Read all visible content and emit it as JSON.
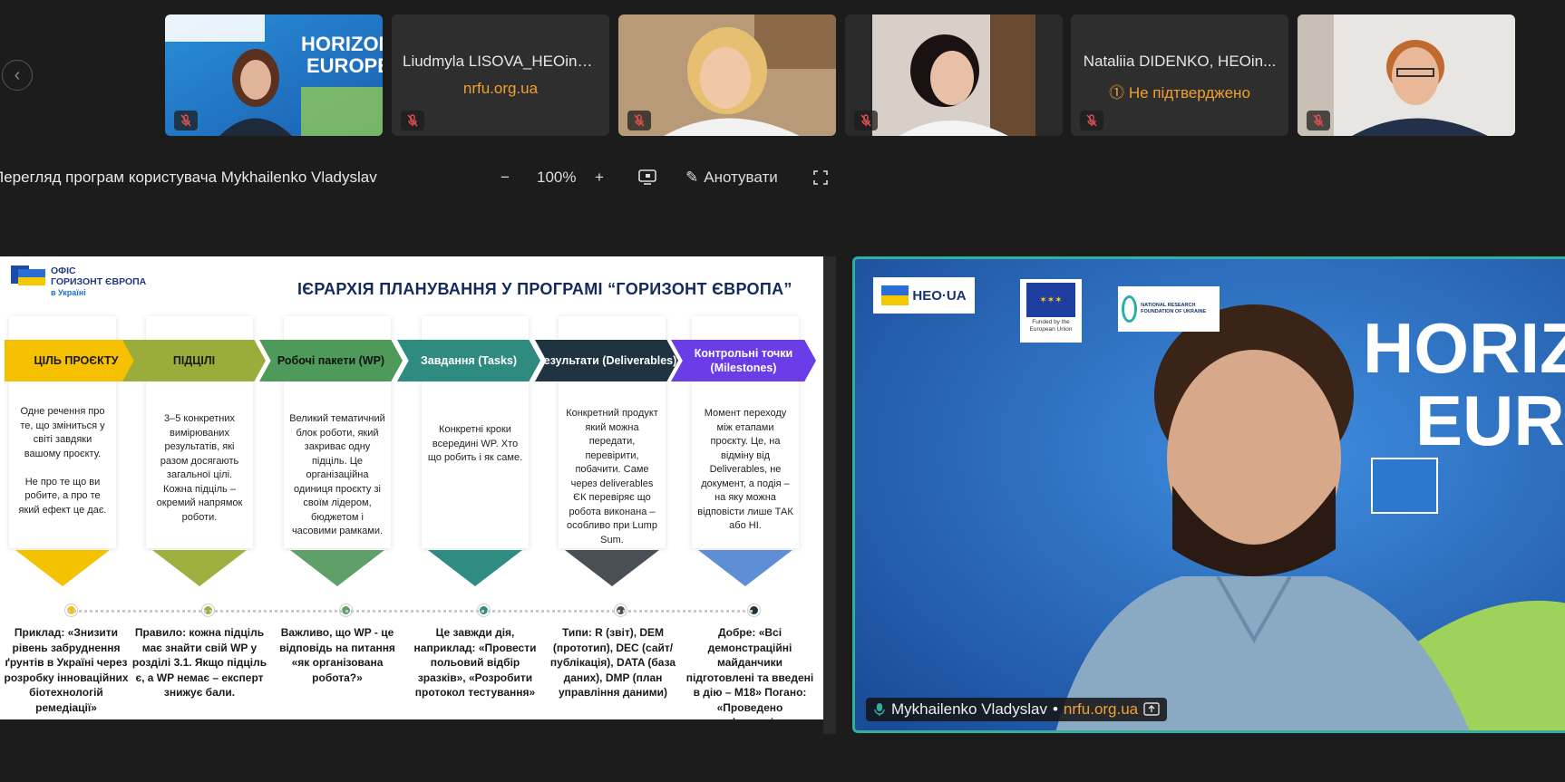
{
  "participants": [
    {
      "name": "",
      "sub": "",
      "muted": true,
      "has_video": true
    },
    {
      "name": "Liudmyla LISOVA_HEOinUA",
      "sub": "nrfu.org.ua",
      "muted": true,
      "has_video": false
    },
    {
      "name": "",
      "sub": "",
      "muted": true,
      "has_video": true
    },
    {
      "name": "",
      "sub": "",
      "muted": true,
      "has_video": true
    },
    {
      "name": "Nataliia DIDENKO, HEOin...",
      "sub": "Не підтверджено",
      "muted": true,
      "has_video": false
    },
    {
      "name": "",
      "sub": "",
      "muted": true,
      "has_video": true
    }
  ],
  "share": {
    "title": "Перегляд програм користувача Mykhailenko Vladyslav",
    "zoom_out": "−",
    "zoom": "100%",
    "zoom_in": "+",
    "annotate": "Анотувати"
  },
  "slide": {
    "logo_line1": "ОФІС",
    "logo_line2": "ГОРИЗОНТ ЄВРОПА",
    "logo_line3": "в Україні",
    "title": "ІЄРАРХІЯ ПЛАНУВАННЯ У ПРОГРАМІ “ГОРИЗОНТ ЄВРОПА”",
    "columns": [
      {
        "header": "ЦІЛЬ ПРОЄКТУ",
        "color": "#f5c000",
        "text_color": "#1a1a1a",
        "chev_color": "#f5c200",
        "desc": "Одне речення про те, що зміниться у світі завдяки вашому проєкту.\n\nНе про те що ви робите, а про те який ефект це дає.",
        "bottom": "Приклад: «Знизити рівень забруднення ґрунтів в Україні через розробку інноваційних біотехнологій ремедіації»"
      },
      {
        "header": "ПІДЦІЛІ",
        "color": "#9aad3a",
        "text_color": "#1a1a1a",
        "chev_color": "#9fb040",
        "desc": "3–5 конкретних вимірюваних результатів, які разом досягають загальної цілі. Кожна підціль – окремий напрямок роботи.",
        "bottom": "Правило: кожна підціль має знайти свій WP у розділі 3.1. Якщо підціль є, а WP немає – експерт знижує бали."
      },
      {
        "header": "Робочі пакети (WP)",
        "color": "#4e9a5a",
        "text_color": "#111111",
        "chev_color": "#5ea068",
        "desc": "Великий тематичний блок роботи, який закриває одну підціль. Це організаційна одиниця проєкту зі своїм лідером, бюджетом і часовими рамками.",
        "bottom": "Важливо, що WP - це відповідь на питання «як організована робота?»"
      },
      {
        "header": "Завдання (Tasks)",
        "color": "#2f8a80",
        "text_color": "#ffffff",
        "chev_color": "#2f8c82",
        "desc": "Конкретні кроки всередині WP. Хто що робить і як саме.",
        "bottom": "Це завжди дія, наприклад: «Провести польовий відбір зразків», «Розробити протокол тестування»"
      },
      {
        "header": "Результати (Deliverables)",
        "color": "#1f3340",
        "text_color": "#ffffff",
        "chev_color": "#4a4f55",
        "desc": "Конкретний продукт який можна передати, перевірити, побачити. Саме через deliverables ЄК перевіряє що робота виконана – особливо при Lump Sum.",
        "bottom": "Типи: R (звіт), DEM (прототип), DEC (сайт/публікація), DATA (база даних), DMP (план управління даними)"
      },
      {
        "header": "Контрольні точки (Milestones)",
        "color": "#6a3de8",
        "text_color": "#ffffff",
        "chev_color": "#5e8fd6",
        "desc": "Момент переходу між етапами проєкту. Це, на відміну від Deliverables, не документ, а подія – на яку можна відповісти лише ТАК або НІ.",
        "bottom": "Добре: «Всі демонстраційні майданчики підготовлені та введені в дію – M18» Погано: «Проведено конференцію»"
      }
    ]
  },
  "speaker": {
    "name": "Mykhailenko Vladyslav",
    "separator": "•",
    "org": "nrfu.org.ua",
    "logo_heo": "HEO·UA",
    "logo_eu": "Funded by the European Union",
    "logo_nrfu": "NATIONAL RESEARCH FOUNDATION OF UKRAINE",
    "bg_text": "HORIZ EURO"
  },
  "colors": {
    "accent_orange": "#f0a030",
    "active_border": "#2fb0a0"
  }
}
